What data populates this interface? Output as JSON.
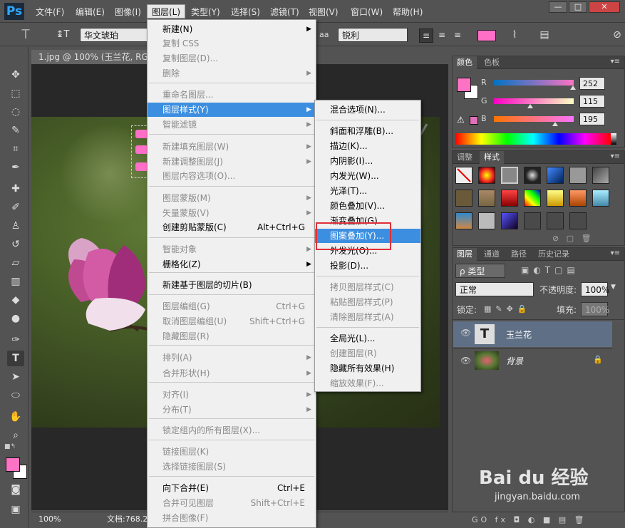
{
  "menubar": {
    "logo": "Ps",
    "items": [
      "文件(F)",
      "编辑(E)",
      "图像(I)",
      "图层(L)",
      "类型(Y)",
      "选择(S)",
      "滤镜(T)",
      "视图(V)",
      "窗口(W)",
      "帮助(H)"
    ],
    "win_min": "—",
    "win_max": "□",
    "win_close": "✕"
  },
  "options": {
    "tool_glyph": "T",
    "orient_glyph": "↨T",
    "font_family": "华文琥珀",
    "aa_label": "aa",
    "antialias": "锐利",
    "text_color": "#ff6ec7"
  },
  "document": {
    "tab_title": "1.jpg @ 100% (玉兰花, RGB/8)",
    "zoom": "100%",
    "doc_info": "文档:768.2"
  },
  "layer_menu": {
    "items": [
      {
        "label": "新建(N)",
        "shortcut": "",
        "arrow": true,
        "disabled": false
      },
      {
        "label": "复制 CSS",
        "shortcut": "",
        "arrow": false,
        "disabled": true
      },
      {
        "label": "复制图层(D)...",
        "shortcut": "",
        "arrow": false,
        "disabled": true
      },
      {
        "label": "删除",
        "shortcut": "",
        "arrow": true,
        "disabled": true
      },
      {
        "label": "重命名图层...",
        "shortcut": "",
        "arrow": false,
        "disabled": true
      },
      {
        "label": "图层样式(Y)",
        "shortcut": "",
        "arrow": true,
        "disabled": false,
        "highlight": true
      },
      {
        "label": "智能滤镜",
        "shortcut": "",
        "arrow": true,
        "disabled": true
      },
      {
        "label": "新建填充图层(W)",
        "shortcut": "",
        "arrow": true,
        "disabled": true
      },
      {
        "label": "新建调整图层(J)",
        "shortcut": "",
        "arrow": true,
        "disabled": true
      },
      {
        "label": "图层内容选项(O)...",
        "shortcut": "",
        "arrow": false,
        "disabled": true
      },
      {
        "label": "图层蒙版(M)",
        "shortcut": "",
        "arrow": true,
        "disabled": true
      },
      {
        "label": "矢量蒙版(V)",
        "shortcut": "",
        "arrow": true,
        "disabled": true
      },
      {
        "label": "创建剪贴蒙版(C)",
        "shortcut": "Alt+Ctrl+G",
        "arrow": false,
        "disabled": false
      },
      {
        "label": "智能对象",
        "shortcut": "",
        "arrow": true,
        "disabled": true
      },
      {
        "label": "栅格化(Z)",
        "shortcut": "",
        "arrow": true,
        "disabled": false
      },
      {
        "label": "新建基于图层的切片(B)",
        "shortcut": "",
        "arrow": false,
        "disabled": false
      },
      {
        "label": "图层编组(G)",
        "shortcut": "Ctrl+G",
        "arrow": false,
        "disabled": true
      },
      {
        "label": "取消图层编组(U)",
        "shortcut": "Shift+Ctrl+G",
        "arrow": false,
        "disabled": true
      },
      {
        "label": "隐藏图层(R)",
        "shortcut": "",
        "arrow": false,
        "disabled": true
      },
      {
        "label": "排列(A)",
        "shortcut": "",
        "arrow": true,
        "disabled": true
      },
      {
        "label": "合并形状(H)",
        "shortcut": "",
        "arrow": true,
        "disabled": true
      },
      {
        "label": "对齐(I)",
        "shortcut": "",
        "arrow": true,
        "disabled": true
      },
      {
        "label": "分布(T)",
        "shortcut": "",
        "arrow": true,
        "disabled": true
      },
      {
        "label": "锁定组内的所有图层(X)...",
        "shortcut": "",
        "arrow": false,
        "disabled": true
      },
      {
        "label": "链接图层(K)",
        "shortcut": "",
        "arrow": false,
        "disabled": true
      },
      {
        "label": "选择链接图层(S)",
        "shortcut": "",
        "arrow": false,
        "disabled": true
      },
      {
        "label": "向下合并(E)",
        "shortcut": "Ctrl+E",
        "arrow": false,
        "disabled": false
      },
      {
        "label": "合并可见图层",
        "shortcut": "Shift+Ctrl+E",
        "arrow": false,
        "disabled": true
      },
      {
        "label": "拼合图像(F)",
        "shortcut": "",
        "arrow": false,
        "disabled": true
      }
    ]
  },
  "style_submenu": {
    "items": [
      {
        "label": "混合选项(N)...",
        "disabled": false
      },
      {
        "label": "斜面和浮雕(B)...",
        "disabled": false
      },
      {
        "label": "描边(K)...",
        "disabled": false
      },
      {
        "label": "内阴影(I)...",
        "disabled": false
      },
      {
        "label": "内发光(W)...",
        "disabled": false
      },
      {
        "label": "光泽(T)...",
        "disabled": false
      },
      {
        "label": "颜色叠加(V)...",
        "disabled": false
      },
      {
        "label": "渐变叠加(G)...",
        "disabled": false
      },
      {
        "label": "图案叠加(Y)...",
        "disabled": false,
        "highlight": true
      },
      {
        "label": "外发光(O)...",
        "disabled": false
      },
      {
        "label": "投影(D)...",
        "disabled": false
      },
      {
        "label": "拷贝图层样式(C)",
        "disabled": true
      },
      {
        "label": "粘贴图层样式(P)",
        "disabled": true
      },
      {
        "label": "清除图层样式(A)",
        "disabled": true
      },
      {
        "label": "全局光(L)...",
        "disabled": false
      },
      {
        "label": "创建图层(R)",
        "disabled": true
      },
      {
        "label": "隐藏所有效果(H)",
        "disabled": false
      },
      {
        "label": "缩放效果(F)...",
        "disabled": true
      }
    ]
  },
  "color_panel": {
    "tabs": [
      "颜色",
      "色板"
    ],
    "r_label": "R",
    "g_label": "G",
    "b_label": "B",
    "r": "252",
    "g": "115",
    "b": "195",
    "fg_color": "#fc73c3",
    "r_frac": 0.988,
    "g_frac": 0.451,
    "b_frac": 0.765
  },
  "styles_panel": {
    "tabs": [
      "调整",
      "样式"
    ]
  },
  "layers_panel": {
    "tabs": [
      "图层",
      "通道",
      "路径",
      "历史记录"
    ],
    "filter_label": "ρ 类型",
    "blend_mode": "正常",
    "opacity_label": "不透明度:",
    "opacity": "100%",
    "lock_label": "锁定:",
    "fill_label": "填充:",
    "fill": "100%",
    "layers": [
      {
        "name": "玉兰花",
        "type": "text",
        "thumb": "T"
      },
      {
        "name": "背景",
        "type": "image"
      }
    ],
    "footer_icons": "GO  fx  ◘  ◐  ■  ▤  🗑"
  },
  "watermark": {
    "brand": "Bai du 经验",
    "url": "jingyan.baidu.com"
  }
}
